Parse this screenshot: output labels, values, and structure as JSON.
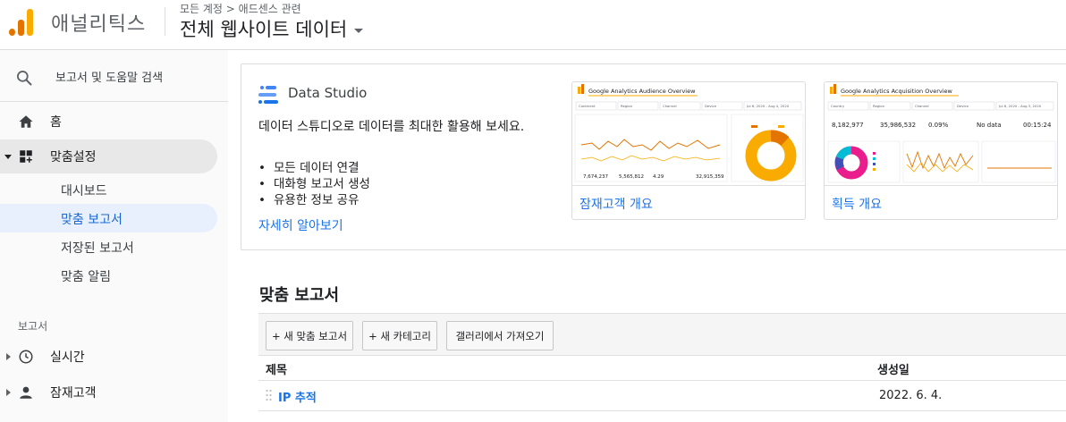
{
  "header": {
    "app_name": "애널리틱스",
    "breadcrumb": "모든 계정 > 애드센스 관련",
    "view_title": "전체 웹사이트 데이터"
  },
  "sidebar": {
    "search_label": "보고서 및 도움말 검색",
    "home_label": "홈",
    "customization_label": "맞춤설정",
    "sub_items": [
      "대시보드",
      "맞춤 보고서",
      "저장된 보고서",
      "맞춤 알림"
    ],
    "reports_section": "보고서",
    "realtime_label": "실시간",
    "audience_label": "잠재고객"
  },
  "data_studio": {
    "title": "Data Studio",
    "description": "데이터 스튜디오로 데이터를 최대한 활용해 보세요.",
    "bullets": [
      "모든 데이터 연결",
      "대화형 보고서 생성",
      "유용한 정보 공유"
    ],
    "learn_more": "자세히 알아보기",
    "templates": [
      {
        "caption": "잠재고객 개요",
        "preview_title": "Google Analytics Audience Overview",
        "filters": [
          "Continent",
          "Region",
          "Channel",
          "Device"
        ],
        "date_range": "Jul 6, 2020 - Aug 4, 2020",
        "stats": [
          "7,674,237",
          "5,565,812",
          "4.29",
          "32,915,359"
        ]
      },
      {
        "caption": "획득 개요",
        "preview_title": "Google Analytics Acquisition Overview",
        "filters": [
          "Country",
          "Region",
          "Channel",
          "Device"
        ],
        "date_range": "Jul 6, 2020 - Aug 3, 2020",
        "stats": [
          "8,182,977",
          "35,986,532",
          "0.09%",
          "No data",
          "00:15:24"
        ]
      }
    ]
  },
  "custom_reports": {
    "title": "맞춤 보고서",
    "buttons": [
      "+ 새 맞춤 보고서",
      "+ 새 카테고리",
      "갤러리에서 가져오기"
    ],
    "columns": [
      "제목",
      "생성일"
    ],
    "rows": [
      {
        "title": "IP 추적",
        "created": "2022. 6. 4."
      }
    ]
  },
  "colors": {
    "accent_blue": "#1a73e8",
    "ga_orange": "#e37400",
    "ga_yellow": "#f9ab00",
    "active_bg": "#e8f0fe"
  }
}
